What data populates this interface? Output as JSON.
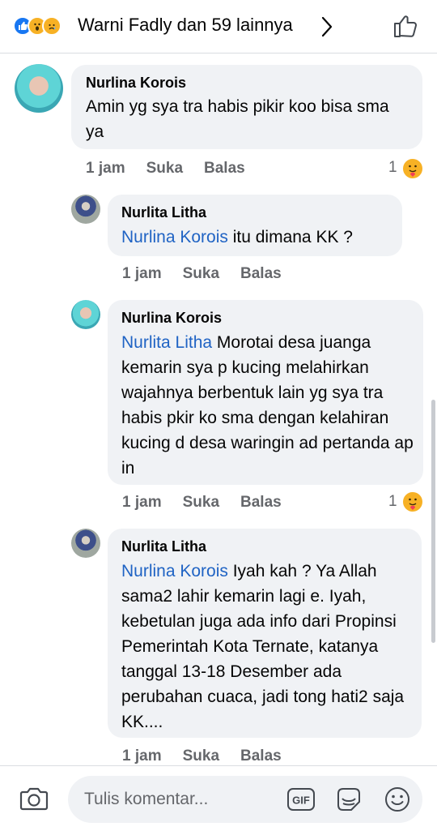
{
  "header": {
    "reactors": "Warni Fadly dan 59 lainnya",
    "reaction_icons": [
      "like-icon",
      "wow-icon",
      "sad-icon"
    ],
    "chevron_icon": "chevron-right-icon",
    "like_button_icon": "thumbs-up-icon"
  },
  "comments": [
    {
      "author": "Nurlina Korois",
      "mention": "",
      "text": "Amin yg sya tra habis pikir koo bisa sma ya",
      "time": "1 jam",
      "like_label": "Suka",
      "reply_label": "Balas",
      "reaction_count": "1"
    },
    {
      "author": "Nurlita Litha",
      "mention": "Nurlina Korois",
      "text": " itu dimana KK ?",
      "time": "1 jam",
      "like_label": "Suka",
      "reply_label": "Balas",
      "reaction_count": ""
    },
    {
      "author": "Nurlina Korois",
      "mention": "Nurlita Litha",
      "text": " Morotai desa juanga kemarin sya p kucing melahirkan wajahnya berbentuk lain yg sya tra habis pkir ko sma dengan kelahiran kucing d desa waringin ad pertanda ap in",
      "time": "1 jam",
      "like_label": "Suka",
      "reply_label": "Balas",
      "reaction_count": "1"
    },
    {
      "author": "Nurlita Litha",
      "mention": "Nurlina Korois",
      "text": " Iyah kah ? Ya Allah sama2 lahir kemarin lagi e. Iyah, kebetulan juga ada info dari Propinsi Pemerintah Kota Ternate, katanya tanggal 13-18 Desember ada perubahan cuaca, jadi tong hati2 saja KK....",
      "time": "1 jam",
      "like_label": "Suka",
      "reply_label": "Balas",
      "reaction_count": ""
    }
  ],
  "composer": {
    "placeholder": "Tulis komentar...",
    "camera_icon": "camera-icon",
    "gif_label": "GIF",
    "sticker_icon": "sticker-icon",
    "emoji_icon": "smiley-icon"
  },
  "colors": {
    "bubble_bg": "#f0f2f5",
    "mention": "#1f63c4",
    "meta_text": "#65676b",
    "like_blue": "#1877f2",
    "reaction_yellow": "#f7b125"
  }
}
